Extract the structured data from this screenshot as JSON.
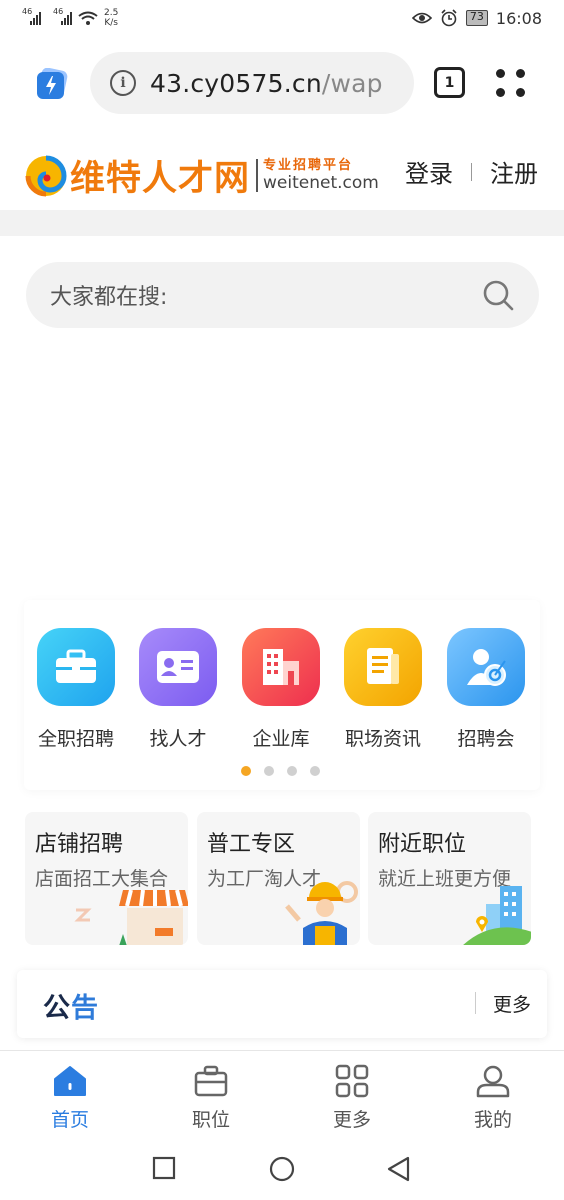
{
  "status_bar": {
    "signal_1": "46",
    "signal_2": "46",
    "speed_value": "2.5",
    "speed_unit": "K/s",
    "battery": "73",
    "time": "16:08"
  },
  "browser": {
    "url_host": "43.cy0575.cn",
    "url_path": "/wap",
    "tab_count": "1"
  },
  "site": {
    "logo_name": "维特人才网",
    "logo_slogan": "专业招聘平台",
    "logo_domain": "weitenet.com",
    "login": "登录",
    "register": "注册"
  },
  "search": {
    "placeholder": "大家都在搜:"
  },
  "categories": [
    {
      "label": "全职招聘",
      "icon": "briefcase-icon",
      "color": "#2ab7f0"
    },
    {
      "label": "找人才",
      "icon": "id-card-icon",
      "color": "#8a6cf0"
    },
    {
      "label": "企业库",
      "icon": "building-icon",
      "color": "#f2474f"
    },
    {
      "label": "职场资讯",
      "icon": "news-icon",
      "color": "#f7b500"
    },
    {
      "label": "招聘会",
      "icon": "job-fair-icon",
      "color": "#3aa5f0"
    }
  ],
  "carousel": {
    "active_page": 1,
    "pages": 4
  },
  "features": [
    {
      "title": "店铺招聘",
      "subtitle": "店面招工大集合"
    },
    {
      "title": "普工专区",
      "subtitle": "为工厂淘人才"
    },
    {
      "title": "附近职位",
      "subtitle": "就近上班更方便"
    }
  ],
  "notice": {
    "title_part1": "公",
    "title_part2": "告",
    "more": "更多"
  },
  "bottom_nav": [
    {
      "label": "首页",
      "icon": "home-icon",
      "active": true
    },
    {
      "label": "职位",
      "icon": "briefcase-outline-icon",
      "active": false
    },
    {
      "label": "更多",
      "icon": "grid-icon",
      "active": false
    },
    {
      "label": "我的",
      "icon": "user-icon",
      "active": false
    }
  ],
  "colors": {
    "brand_orange": "#f07a0c",
    "active_blue": "#2b7de0",
    "carousel_active": "#f5a623"
  }
}
